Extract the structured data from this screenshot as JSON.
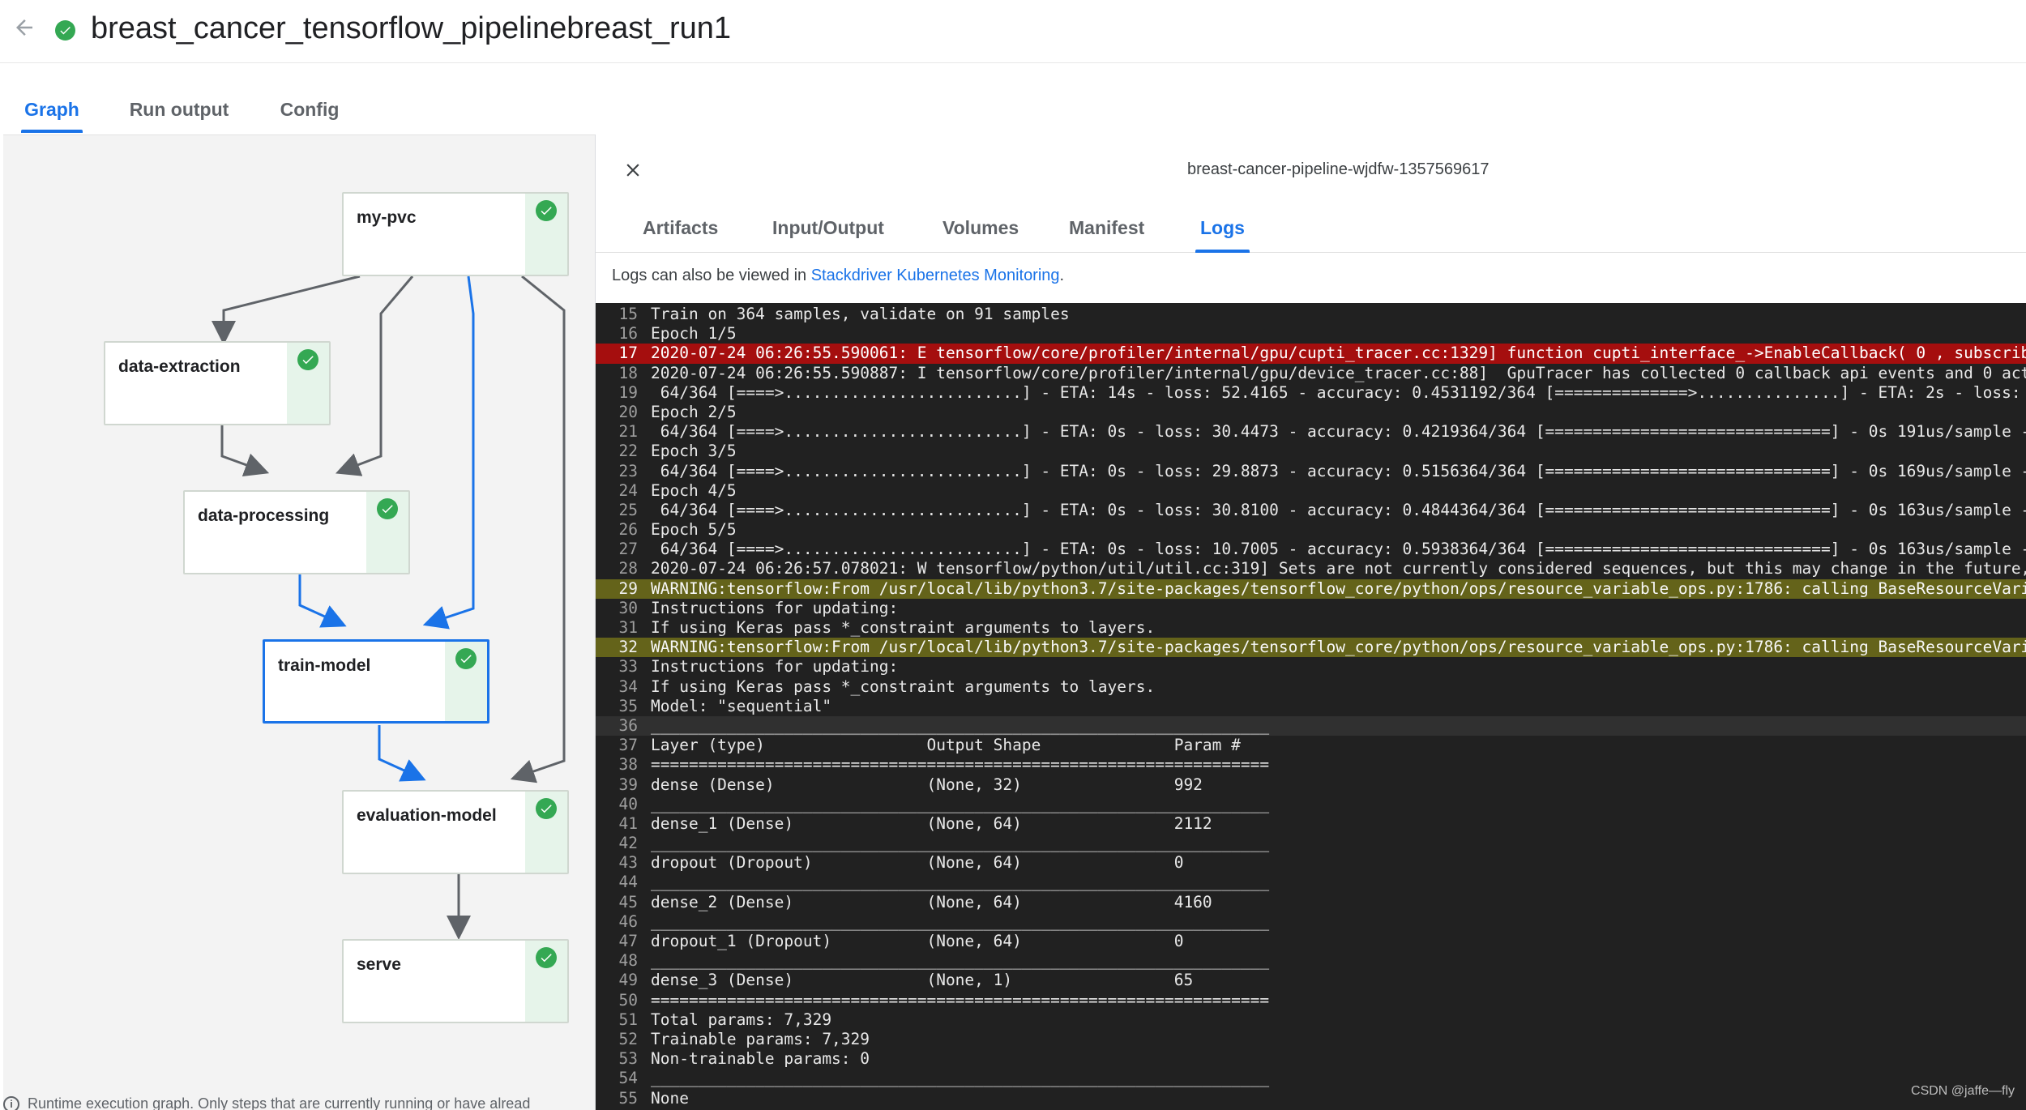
{
  "header": {
    "title": "breast_cancer_tensorflow_pipelinebreast_run1",
    "back_icon": "arrow-back-icon",
    "status_icon": "success-check-icon"
  },
  "main_tabs": [
    {
      "label": "Graph",
      "active": true
    },
    {
      "label": "Run output",
      "active": false
    },
    {
      "label": "Config",
      "active": false
    }
  ],
  "graph": {
    "nodes": [
      {
        "label": "my-pvc",
        "status": "succeeded"
      },
      {
        "label": "data-extraction",
        "status": "succeeded"
      },
      {
        "label": "data-processing",
        "status": "succeeded"
      },
      {
        "label": "train-model",
        "status": "succeeded",
        "selected": true
      },
      {
        "label": "evaluation-model",
        "status": "succeeded"
      },
      {
        "label": "serve",
        "status": "succeeded"
      }
    ],
    "footnote": "Runtime execution graph. Only steps that are currently running or have alread"
  },
  "side_panel": {
    "title": "breast-cancer-pipeline-wjdfw-1357569617",
    "tabs": [
      {
        "label": "Artifacts",
        "active": false
      },
      {
        "label": "Input/Output",
        "active": false
      },
      {
        "label": "Volumes",
        "active": false
      },
      {
        "label": "Manifest",
        "active": false
      },
      {
        "label": "Logs",
        "active": true
      }
    ],
    "logs_note_prefix": "Logs can also be viewed in ",
    "logs_note_link": "Stackdriver Kubernetes Monitoring",
    "logs_note_suffix": "."
  },
  "logs": [
    {
      "n": "15",
      "text": "Train on 364 samples, validate on 91 samples",
      "level": "info"
    },
    {
      "n": "16",
      "text": "Epoch 1/5",
      "level": "info"
    },
    {
      "n": "17",
      "text": "2020-07-24 06:26:55.590061: E tensorflow/core/profiler/internal/gpu/cupti_tracer.cc:1329] function cupti_interface_->EnableCallback( 0 , subscrib",
      "level": "error"
    },
    {
      "n": "18",
      "text": "2020-07-24 06:26:55.590887: I tensorflow/core/profiler/internal/gpu/device_tracer.cc:88]  GpuTracer has collected 0 callback api events and 0 act",
      "level": "info"
    },
    {
      "n": "19",
      "text": " 64/364 [====>.........................] - ETA: 14s - loss: 52.4165 - accuracy: 0.4531192/364 [==============>...............] - ETA: 2s - loss:",
      "level": "info"
    },
    {
      "n": "20",
      "text": "Epoch 2/5",
      "level": "info"
    },
    {
      "n": "21",
      "text": " 64/364 [====>.........................] - ETA: 0s - loss: 30.4473 - accuracy: 0.4219364/364 [==============================] - 0s 191us/sample -",
      "level": "info"
    },
    {
      "n": "22",
      "text": "Epoch 3/5",
      "level": "info"
    },
    {
      "n": "23",
      "text": " 64/364 [====>.........................] - ETA: 0s - loss: 29.8873 - accuracy: 0.5156364/364 [==============================] - 0s 169us/sample -",
      "level": "info"
    },
    {
      "n": "24",
      "text": "Epoch 4/5",
      "level": "info"
    },
    {
      "n": "25",
      "text": " 64/364 [====>.........................] - ETA: 0s - loss: 30.8100 - accuracy: 0.4844364/364 [==============================] - 0s 163us/sample -",
      "level": "info"
    },
    {
      "n": "26",
      "text": "Epoch 5/5",
      "level": "info"
    },
    {
      "n": "27",
      "text": " 64/364 [====>.........................] - ETA: 0s - loss: 10.7005 - accuracy: 0.5938364/364 [==============================] - 0s 163us/sample -",
      "level": "info"
    },
    {
      "n": "28",
      "text": "2020-07-24 06:26:57.078021: W tensorflow/python/util/util.cc:319] Sets are not currently considered sequences, but this may change in the future,",
      "level": "info"
    },
    {
      "n": "29",
      "text": "WARNING:tensorflow:From /usr/local/lib/python3.7/site-packages/tensorflow_core/python/ops/resource_variable_ops.py:1786: calling BaseResourceVari",
      "level": "warn"
    },
    {
      "n": "30",
      "text": "Instructions for updating:",
      "level": "info"
    },
    {
      "n": "31",
      "text": "If using Keras pass *_constraint arguments to layers.",
      "level": "info"
    },
    {
      "n": "32",
      "text": "WARNING:tensorflow:From /usr/local/lib/python3.7/site-packages/tensorflow_core/python/ops/resource_variable_ops.py:1786: calling BaseResourceVari",
      "level": "warn"
    },
    {
      "n": "33",
      "text": "Instructions for updating:",
      "level": "info"
    },
    {
      "n": "34",
      "text": "If using Keras pass *_constraint arguments to layers.",
      "level": "info"
    },
    {
      "n": "35",
      "text": "Model: \"sequential\"",
      "level": "info"
    },
    {
      "n": "36",
      "text": "_________________________________________________________________",
      "level": "hl"
    },
    {
      "n": "37",
      "text": "Layer (type)                 Output Shape              Param #   ",
      "level": "info"
    },
    {
      "n": "38",
      "text": "=================================================================",
      "level": "info"
    },
    {
      "n": "39",
      "text": "dense (Dense)                (None, 32)                992       ",
      "level": "info"
    },
    {
      "n": "40",
      "text": "_________________________________________________________________",
      "level": "info"
    },
    {
      "n": "41",
      "text": "dense_1 (Dense)              (None, 64)                2112      ",
      "level": "info"
    },
    {
      "n": "42",
      "text": "_________________________________________________________________",
      "level": "info"
    },
    {
      "n": "43",
      "text": "dropout (Dropout)            (None, 64)                0         ",
      "level": "info"
    },
    {
      "n": "44",
      "text": "_________________________________________________________________",
      "level": "info"
    },
    {
      "n": "45",
      "text": "dense_2 (Dense)              (None, 64)                4160      ",
      "level": "info"
    },
    {
      "n": "46",
      "text": "_________________________________________________________________",
      "level": "info"
    },
    {
      "n": "47",
      "text": "dropout_1 (Dropout)          (None, 64)                0         ",
      "level": "info"
    },
    {
      "n": "48",
      "text": "_________________________________________________________________",
      "level": "info"
    },
    {
      "n": "49",
      "text": "dense_3 (Dense)              (None, 1)                 65        ",
      "level": "info"
    },
    {
      "n": "50",
      "text": "=================================================================",
      "level": "info"
    },
    {
      "n": "51",
      "text": "Total params: 7,329",
      "level": "info"
    },
    {
      "n": "52",
      "text": "Trainable params: 7,329",
      "level": "info"
    },
    {
      "n": "53",
      "text": "Non-trainable params: 0",
      "level": "info"
    },
    {
      "n": "54",
      "text": "_________________________________________________________________",
      "level": "info"
    },
    {
      "n": "55",
      "text": "None",
      "level": "info"
    }
  ],
  "watermark": "CSDN @jaffe—fly",
  "colors": {
    "accent": "#1a73e8",
    "success": "#34a853",
    "log_bg": "#212121",
    "log_error": "#a50e0e",
    "log_warn": "#64631a"
  }
}
